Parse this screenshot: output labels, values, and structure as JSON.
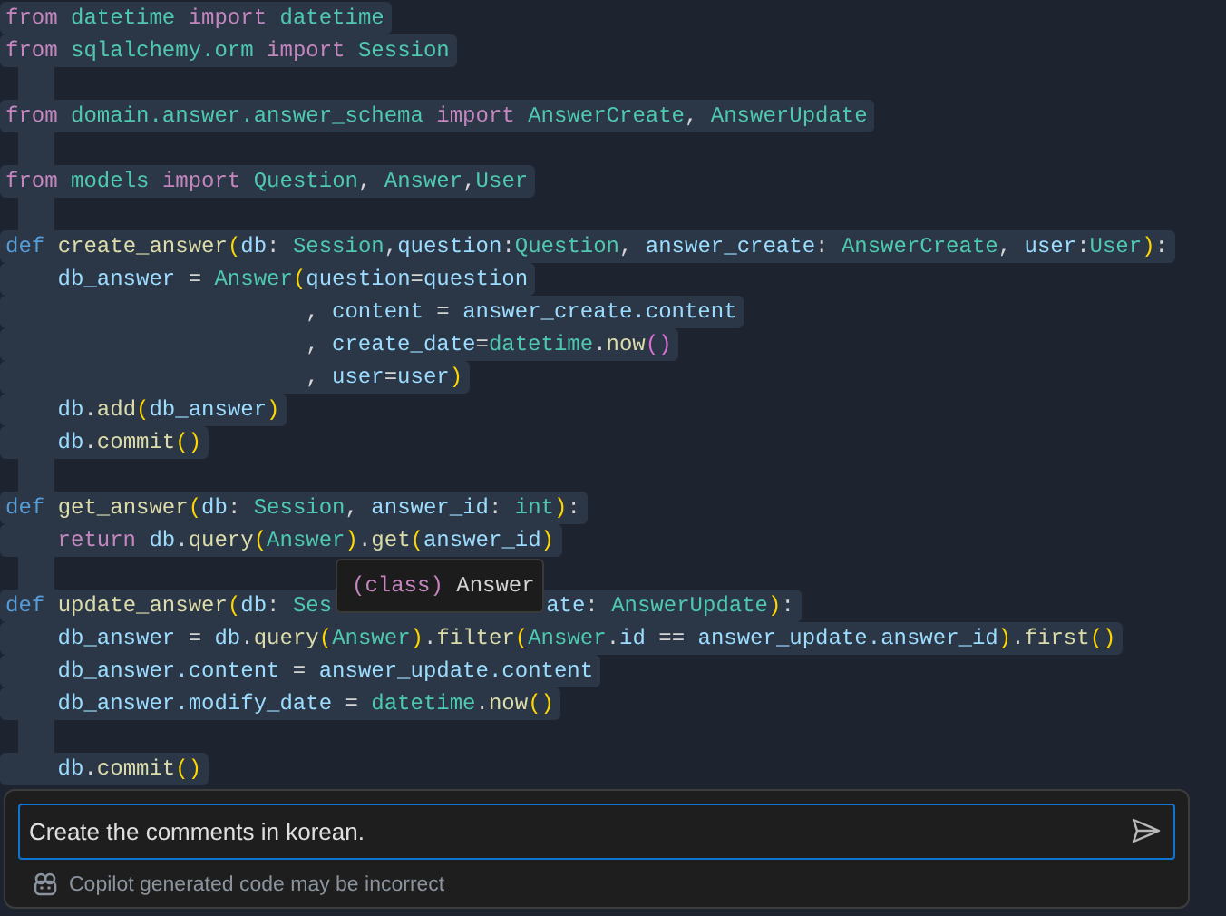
{
  "editor": {
    "lines": [
      {
        "kind": "code",
        "tokens": [
          {
            "kind": "kw",
            "text": "from "
          },
          {
            "kind": "mod",
            "text": "datetime "
          },
          {
            "kind": "kw",
            "text": "import "
          },
          {
            "kind": "mod",
            "text": "datetime"
          }
        ]
      },
      {
        "kind": "code",
        "tokens": [
          {
            "kind": "kw",
            "text": "from "
          },
          {
            "kind": "mod",
            "text": "sqlalchemy.orm "
          },
          {
            "kind": "kw",
            "text": "import "
          },
          {
            "kind": "mod",
            "text": "Session"
          }
        ]
      },
      {
        "kind": "blank"
      },
      {
        "kind": "code",
        "tokens": [
          {
            "kind": "kw",
            "text": "from "
          },
          {
            "kind": "mod",
            "text": "domain.answer.answer_schema "
          },
          {
            "kind": "kw",
            "text": "import "
          },
          {
            "kind": "mod",
            "text": "AnswerCreate"
          },
          {
            "kind": "p",
            "text": ", "
          },
          {
            "kind": "mod",
            "text": "AnswerUpdate"
          }
        ]
      },
      {
        "kind": "blank"
      },
      {
        "kind": "code",
        "tokens": [
          {
            "kind": "kw",
            "text": "from "
          },
          {
            "kind": "mod",
            "text": "models "
          },
          {
            "kind": "kw",
            "text": "import "
          },
          {
            "kind": "mod",
            "text": "Question"
          },
          {
            "kind": "p",
            "text": ", "
          },
          {
            "kind": "mod",
            "text": "Answer"
          },
          {
            "kind": "p",
            "text": ","
          },
          {
            "kind": "mod",
            "text": "User"
          }
        ]
      },
      {
        "kind": "blank"
      },
      {
        "kind": "code",
        "tokens": [
          {
            "kind": "def",
            "text": "def "
          },
          {
            "kind": "fn",
            "text": "create_answer"
          },
          {
            "kind": "br1",
            "text": "("
          },
          {
            "kind": "var",
            "text": "db"
          },
          {
            "kind": "p",
            "text": ": "
          },
          {
            "kind": "mod",
            "text": "Session"
          },
          {
            "kind": "p",
            "text": ","
          },
          {
            "kind": "var",
            "text": "question"
          },
          {
            "kind": "p",
            "text": ":"
          },
          {
            "kind": "mod",
            "text": "Question"
          },
          {
            "kind": "p",
            "text": ", "
          },
          {
            "kind": "var",
            "text": "answer_create"
          },
          {
            "kind": "p",
            "text": ": "
          },
          {
            "kind": "mod",
            "text": "AnswerCreate"
          },
          {
            "kind": "p",
            "text": ", "
          },
          {
            "kind": "var",
            "text": "user"
          },
          {
            "kind": "p",
            "text": ":"
          },
          {
            "kind": "mod",
            "text": "User"
          },
          {
            "kind": "br1",
            "text": ")"
          },
          {
            "kind": "p",
            "text": ":"
          }
        ]
      },
      {
        "kind": "code",
        "tokens": [
          {
            "kind": "var",
            "text": "    db_answer"
          },
          {
            "kind": "p",
            "text": " = "
          },
          {
            "kind": "mod",
            "text": "Answer"
          },
          {
            "kind": "br1",
            "text": "("
          },
          {
            "kind": "var",
            "text": "question"
          },
          {
            "kind": "p",
            "text": "="
          },
          {
            "kind": "var",
            "text": "question"
          }
        ]
      },
      {
        "kind": "code",
        "tokens": [
          {
            "kind": "p",
            "text": "                       , "
          },
          {
            "kind": "var",
            "text": "content"
          },
          {
            "kind": "p",
            "text": " = "
          },
          {
            "kind": "var",
            "text": "answer_create.content"
          }
        ]
      },
      {
        "kind": "code",
        "tokens": [
          {
            "kind": "p",
            "text": "                       , "
          },
          {
            "kind": "var",
            "text": "create_date"
          },
          {
            "kind": "p",
            "text": "="
          },
          {
            "kind": "mod",
            "text": "datetime"
          },
          {
            "kind": "p",
            "text": "."
          },
          {
            "kind": "fn",
            "text": "now"
          },
          {
            "kind": "br2",
            "text": "()"
          }
        ]
      },
      {
        "kind": "code",
        "tokens": [
          {
            "kind": "p",
            "text": "                       , "
          },
          {
            "kind": "var",
            "text": "user"
          },
          {
            "kind": "p",
            "text": "="
          },
          {
            "kind": "var",
            "text": "user"
          },
          {
            "kind": "br1",
            "text": ")"
          }
        ]
      },
      {
        "kind": "code",
        "tokens": [
          {
            "kind": "var",
            "text": "    db"
          },
          {
            "kind": "p",
            "text": "."
          },
          {
            "kind": "fn",
            "text": "add"
          },
          {
            "kind": "br1",
            "text": "("
          },
          {
            "kind": "var",
            "text": "db_answer"
          },
          {
            "kind": "br1",
            "text": ")"
          }
        ]
      },
      {
        "kind": "code",
        "tokens": [
          {
            "kind": "var",
            "text": "    db"
          },
          {
            "kind": "p",
            "text": "."
          },
          {
            "kind": "fn",
            "text": "commit"
          },
          {
            "kind": "br1",
            "text": "()"
          }
        ]
      },
      {
        "kind": "blank"
      },
      {
        "kind": "code",
        "tokens": [
          {
            "kind": "def",
            "text": "def "
          },
          {
            "kind": "fn",
            "text": "get_answer"
          },
          {
            "kind": "br1",
            "text": "("
          },
          {
            "kind": "var",
            "text": "db"
          },
          {
            "kind": "p",
            "text": ": "
          },
          {
            "kind": "mod",
            "text": "Session"
          },
          {
            "kind": "p",
            "text": ", "
          },
          {
            "kind": "var",
            "text": "answer_id"
          },
          {
            "kind": "p",
            "text": ": "
          },
          {
            "kind": "mod",
            "text": "int"
          },
          {
            "kind": "br1",
            "text": ")"
          },
          {
            "kind": "p",
            "text": ":"
          }
        ]
      },
      {
        "kind": "code",
        "tokens": [
          {
            "kind": "kw",
            "text": "    return "
          },
          {
            "kind": "var",
            "text": "db"
          },
          {
            "kind": "p",
            "text": "."
          },
          {
            "kind": "fn",
            "text": "query"
          },
          {
            "kind": "br1",
            "text": "("
          },
          {
            "kind": "mod",
            "text": "Answer"
          },
          {
            "kind": "br1",
            "text": ")"
          },
          {
            "kind": "p",
            "text": "."
          },
          {
            "kind": "fn",
            "text": "get"
          },
          {
            "kind": "br1",
            "text": "("
          },
          {
            "kind": "var",
            "text": "answer_id"
          },
          {
            "kind": "br1",
            "text": ")"
          }
        ]
      },
      {
        "kind": "blank"
      },
      {
        "kind": "code",
        "tokens": [
          {
            "kind": "def",
            "text": "def "
          },
          {
            "kind": "fn",
            "text": "update_answer"
          },
          {
            "kind": "br1",
            "text": "("
          },
          {
            "kind": "var",
            "text": "db"
          },
          {
            "kind": "p",
            "text": ": "
          },
          {
            "kind": "mod",
            "text": "Ses"
          },
          {
            "kind": "covered"
          },
          {
            "kind": "var",
            "text": "ate"
          },
          {
            "kind": "p",
            "text": ": "
          },
          {
            "kind": "mod",
            "text": "AnswerUpdate"
          },
          {
            "kind": "br1",
            "text": ")"
          },
          {
            "kind": "p",
            "text": ":"
          }
        ]
      },
      {
        "kind": "code",
        "tokens": [
          {
            "kind": "var",
            "text": "    db_answer"
          },
          {
            "kind": "p",
            "text": " = "
          },
          {
            "kind": "var",
            "text": "db"
          },
          {
            "kind": "p",
            "text": "."
          },
          {
            "kind": "fn",
            "text": "query"
          },
          {
            "kind": "br1",
            "text": "("
          },
          {
            "kind": "mod",
            "text": "Answer"
          },
          {
            "kind": "br1",
            "text": ")"
          },
          {
            "kind": "p",
            "text": "."
          },
          {
            "kind": "fn",
            "text": "filter"
          },
          {
            "kind": "br1",
            "text": "("
          },
          {
            "kind": "mod",
            "text": "Answer"
          },
          {
            "kind": "p",
            "text": "."
          },
          {
            "kind": "var",
            "text": "id"
          },
          {
            "kind": "p",
            "text": " == "
          },
          {
            "kind": "var",
            "text": "answer_update.answer_id"
          },
          {
            "kind": "br1",
            "text": ")"
          },
          {
            "kind": "p",
            "text": "."
          },
          {
            "kind": "fn",
            "text": "first"
          },
          {
            "kind": "br1",
            "text": "()"
          }
        ]
      },
      {
        "kind": "code",
        "tokens": [
          {
            "kind": "var",
            "text": "    db_answer.content"
          },
          {
            "kind": "p",
            "text": " = "
          },
          {
            "kind": "var",
            "text": "answer_update.content"
          }
        ]
      },
      {
        "kind": "code",
        "tokens": [
          {
            "kind": "var",
            "text": "    db_answer.modify_date"
          },
          {
            "kind": "p",
            "text": " = "
          },
          {
            "kind": "mod",
            "text": "datetime"
          },
          {
            "kind": "p",
            "text": "."
          },
          {
            "kind": "fn",
            "text": "now"
          },
          {
            "kind": "br1",
            "text": "()"
          }
        ]
      },
      {
        "kind": "blank"
      },
      {
        "kind": "code",
        "tokens": [
          {
            "kind": "var",
            "text": "    db"
          },
          {
            "kind": "p",
            "text": "."
          },
          {
            "kind": "fn",
            "text": "commit"
          },
          {
            "kind": "br1",
            "text": "()"
          }
        ]
      }
    ],
    "tooltip": {
      "keyword": "(class)",
      "name": "Answer"
    }
  },
  "chat": {
    "input_value": "Create the comments in korean.",
    "disclaimer": "Copilot generated code may be incorrect"
  }
}
